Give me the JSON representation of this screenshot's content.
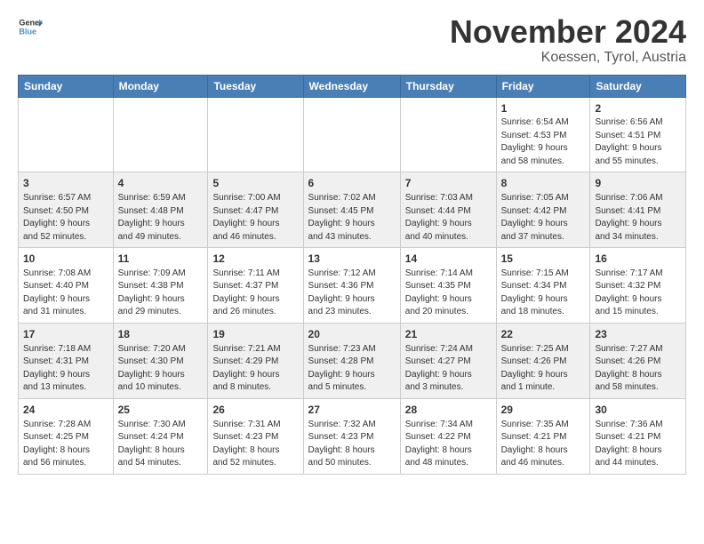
{
  "logo": {
    "line1": "General",
    "line2": "Blue"
  },
  "title": "November 2024",
  "location": "Koessen, Tyrol, Austria",
  "days_of_week": [
    "Sunday",
    "Monday",
    "Tuesday",
    "Wednesday",
    "Thursday",
    "Friday",
    "Saturday"
  ],
  "weeks": [
    [
      {
        "day": "",
        "info": ""
      },
      {
        "day": "",
        "info": ""
      },
      {
        "day": "",
        "info": ""
      },
      {
        "day": "",
        "info": ""
      },
      {
        "day": "",
        "info": ""
      },
      {
        "day": "1",
        "info": "Sunrise: 6:54 AM\nSunset: 4:53 PM\nDaylight: 9 hours\nand 58 minutes."
      },
      {
        "day": "2",
        "info": "Sunrise: 6:56 AM\nSunset: 4:51 PM\nDaylight: 9 hours\nand 55 minutes."
      }
    ],
    [
      {
        "day": "3",
        "info": "Sunrise: 6:57 AM\nSunset: 4:50 PM\nDaylight: 9 hours\nand 52 minutes."
      },
      {
        "day": "4",
        "info": "Sunrise: 6:59 AM\nSunset: 4:48 PM\nDaylight: 9 hours\nand 49 minutes."
      },
      {
        "day": "5",
        "info": "Sunrise: 7:00 AM\nSunset: 4:47 PM\nDaylight: 9 hours\nand 46 minutes."
      },
      {
        "day": "6",
        "info": "Sunrise: 7:02 AM\nSunset: 4:45 PM\nDaylight: 9 hours\nand 43 minutes."
      },
      {
        "day": "7",
        "info": "Sunrise: 7:03 AM\nSunset: 4:44 PM\nDaylight: 9 hours\nand 40 minutes."
      },
      {
        "day": "8",
        "info": "Sunrise: 7:05 AM\nSunset: 4:42 PM\nDaylight: 9 hours\nand 37 minutes."
      },
      {
        "day": "9",
        "info": "Sunrise: 7:06 AM\nSunset: 4:41 PM\nDaylight: 9 hours\nand 34 minutes."
      }
    ],
    [
      {
        "day": "10",
        "info": "Sunrise: 7:08 AM\nSunset: 4:40 PM\nDaylight: 9 hours\nand 31 minutes."
      },
      {
        "day": "11",
        "info": "Sunrise: 7:09 AM\nSunset: 4:38 PM\nDaylight: 9 hours\nand 29 minutes."
      },
      {
        "day": "12",
        "info": "Sunrise: 7:11 AM\nSunset: 4:37 PM\nDaylight: 9 hours\nand 26 minutes."
      },
      {
        "day": "13",
        "info": "Sunrise: 7:12 AM\nSunset: 4:36 PM\nDaylight: 9 hours\nand 23 minutes."
      },
      {
        "day": "14",
        "info": "Sunrise: 7:14 AM\nSunset: 4:35 PM\nDaylight: 9 hours\nand 20 minutes."
      },
      {
        "day": "15",
        "info": "Sunrise: 7:15 AM\nSunset: 4:34 PM\nDaylight: 9 hours\nand 18 minutes."
      },
      {
        "day": "16",
        "info": "Sunrise: 7:17 AM\nSunset: 4:32 PM\nDaylight: 9 hours\nand 15 minutes."
      }
    ],
    [
      {
        "day": "17",
        "info": "Sunrise: 7:18 AM\nSunset: 4:31 PM\nDaylight: 9 hours\nand 13 minutes."
      },
      {
        "day": "18",
        "info": "Sunrise: 7:20 AM\nSunset: 4:30 PM\nDaylight: 9 hours\nand 10 minutes."
      },
      {
        "day": "19",
        "info": "Sunrise: 7:21 AM\nSunset: 4:29 PM\nDaylight: 9 hours\nand 8 minutes."
      },
      {
        "day": "20",
        "info": "Sunrise: 7:23 AM\nSunset: 4:28 PM\nDaylight: 9 hours\nand 5 minutes."
      },
      {
        "day": "21",
        "info": "Sunrise: 7:24 AM\nSunset: 4:27 PM\nDaylight: 9 hours\nand 3 minutes."
      },
      {
        "day": "22",
        "info": "Sunrise: 7:25 AM\nSunset: 4:26 PM\nDaylight: 9 hours\nand 1 minute."
      },
      {
        "day": "23",
        "info": "Sunrise: 7:27 AM\nSunset: 4:26 PM\nDaylight: 8 hours\nand 58 minutes."
      }
    ],
    [
      {
        "day": "24",
        "info": "Sunrise: 7:28 AM\nSunset: 4:25 PM\nDaylight: 8 hours\nand 56 minutes."
      },
      {
        "day": "25",
        "info": "Sunrise: 7:30 AM\nSunset: 4:24 PM\nDaylight: 8 hours\nand 54 minutes."
      },
      {
        "day": "26",
        "info": "Sunrise: 7:31 AM\nSunset: 4:23 PM\nDaylight: 8 hours\nand 52 minutes."
      },
      {
        "day": "27",
        "info": "Sunrise: 7:32 AM\nSunset: 4:23 PM\nDaylight: 8 hours\nand 50 minutes."
      },
      {
        "day": "28",
        "info": "Sunrise: 7:34 AM\nSunset: 4:22 PM\nDaylight: 8 hours\nand 48 minutes."
      },
      {
        "day": "29",
        "info": "Sunrise: 7:35 AM\nSunset: 4:21 PM\nDaylight: 8 hours\nand 46 minutes."
      },
      {
        "day": "30",
        "info": "Sunrise: 7:36 AM\nSunset: 4:21 PM\nDaylight: 8 hours\nand 44 minutes."
      }
    ]
  ]
}
